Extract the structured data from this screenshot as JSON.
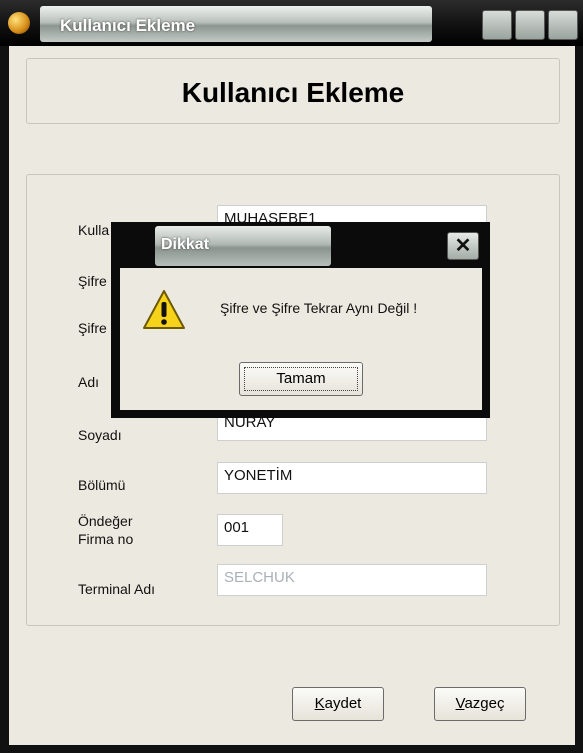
{
  "window": {
    "title": "Kullanıcı Ekleme",
    "heading": "Kullanıcı  Ekleme"
  },
  "form": {
    "fields": [
      {
        "label": "Kullanıcı Adı",
        "value": "MUHASEBE1"
      },
      {
        "label": "Şifre",
        "value": ""
      },
      {
        "label": "Şifre Tekrar",
        "value": ""
      },
      {
        "label": "Adı",
        "value": ""
      },
      {
        "label": "Soyadı",
        "value": "NURAY"
      },
      {
        "label": "Bölümü",
        "value": "YONETİM"
      },
      {
        "label": "Öndeğer\nFirma no",
        "value": "001"
      },
      {
        "label": "Terminal Adı",
        "value": "SELCHUK"
      }
    ],
    "labels": {
      "kullanici": "Kulla",
      "sifre": "Şifre",
      "sifre_tekrar": "Şifre",
      "adi": "Adı",
      "soyadi": "Soyadı",
      "bolumu": "Bölümü",
      "ondeger_line1": "Öndeğer",
      "ondeger_line2": "Firma no",
      "terminal": "Terminal Adı"
    },
    "values": {
      "kullanici": "MUHASEBE1",
      "soyadi": "NURAY",
      "bolumu": "YONETİM",
      "firma_no": "001",
      "terminal": "SELCHUK"
    }
  },
  "buttons": {
    "save_u": "K",
    "save_rest": "aydet",
    "cancel_u": "V",
    "cancel_rest": "azgeç"
  },
  "dialog": {
    "title": "Dikkat",
    "message": "Şifre ve Şifre Tekrar Aynı Değil !",
    "ok_label": "Tamam",
    "close_glyph": "✕",
    "icon": "warning-icon"
  },
  "colors": {
    "frame": "#111111",
    "client_bg": "#ece9e0",
    "warning": "#f6d21a"
  }
}
